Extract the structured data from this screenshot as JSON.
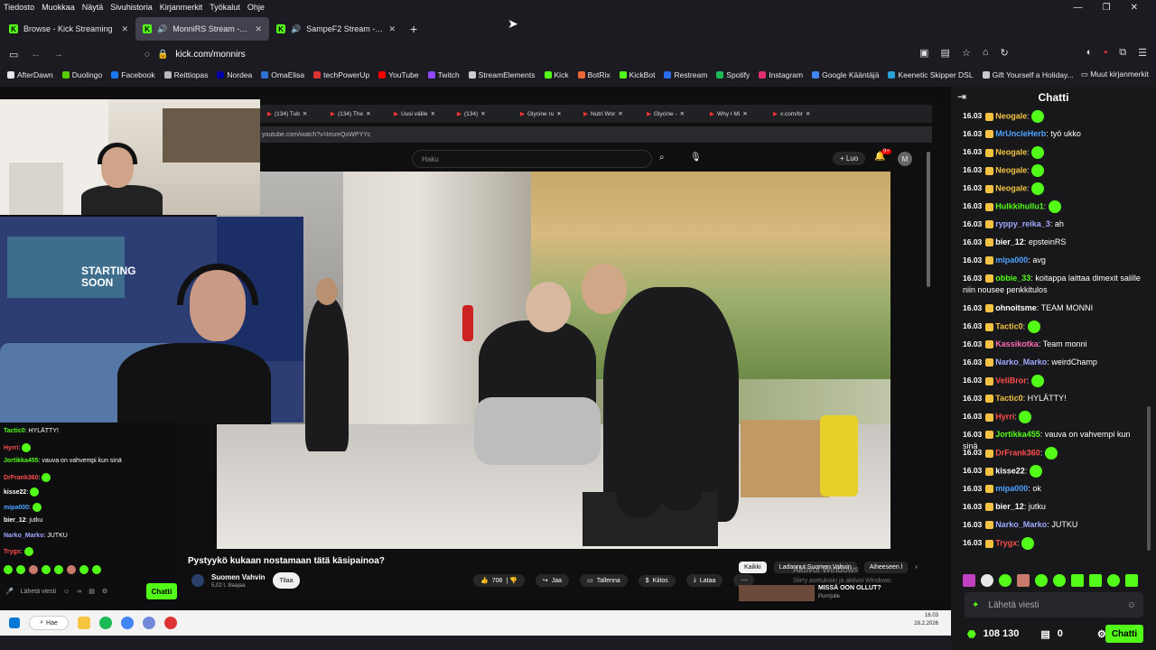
{
  "menubar": [
    "Tiedosto",
    "Muokkaa",
    "Näytä",
    "Sivuhistoria",
    "Kirjanmerkit",
    "Työkalut",
    "Ohje"
  ],
  "window_controls": [
    "—",
    "❐",
    "✕"
  ],
  "tabs": [
    {
      "label": "Browse - Kick Streaming",
      "active": false
    },
    {
      "label": "MonniRS Stream - Watch Li",
      "active": true
    },
    {
      "label": "SampeF2 Stream - Watch Li",
      "active": false
    }
  ],
  "new_tab": "+",
  "address": "kick.com/monnirs",
  "bookmarks": [
    {
      "label": "AfterDawn",
      "color": "#e8e8ea"
    },
    {
      "label": "Duolingo",
      "color": "#58cc02"
    },
    {
      "label": "Facebook",
      "color": "#1877f2"
    },
    {
      "label": "Reittiopas",
      "color": "#bbbbbb"
    },
    {
      "label": "Nordea",
      "color": "#0000a0"
    },
    {
      "label": "OmaElisa",
      "color": "#2f6fd6"
    },
    {
      "label": "techPowerUp",
      "color": "#d33"
    },
    {
      "label": "YouTube",
      "color": "#ff0000"
    },
    {
      "label": "Twitch",
      "color": "#9146ff"
    },
    {
      "label": "StreamElements",
      "color": "#cccccc"
    },
    {
      "label": "Kick",
      "color": "#53fc18"
    },
    {
      "label": "BotRix",
      "color": "#e63"
    },
    {
      "label": "KickBot",
      "color": "#53fc18"
    },
    {
      "label": "Restream",
      "color": "#2a6df4"
    },
    {
      "label": "Spotify",
      "color": "#1db954"
    },
    {
      "label": "Instagram",
      "color": "#e1306c"
    },
    {
      "label": "Google Kääntäjä",
      "color": "#4285f4"
    },
    {
      "label": "Keenetic Skipper DSL",
      "color": "#2a9fd6"
    },
    {
      "label": "Gift Yourself a Holiday...",
      "color": "#cccccc"
    }
  ],
  "other_bookmarks": "Muut kirjanmerkit",
  "youtube": {
    "tabs": [
      "(134) Tub",
      "(134) The",
      "Uusi välile",
      "(134) ",
      "Glycine ru",
      "Nutri Wor",
      "Glycine - ",
      "Why I Mi",
      "x.com/br"
    ],
    "url": "youtube.com/watch?v=ImzeQoWPYYc",
    "search_placeholder": "Haku",
    "create_label": "Luo",
    "notif_count": "9+",
    "avatar": "M",
    "video_title": "Pystyykö kukaan nostamaan tätä käsipainoa?",
    "channel": "Suomen Vahvin",
    "subs": "5,02 t. tilaajaa",
    "subscribe": "Tilaa",
    "likes": "706",
    "share": "Jaa",
    "save": "Tallenna",
    "thanks": "Kiitos",
    "download": "Lataa",
    "chips": [
      "Kaikki",
      "Ladannut Suomen Vahvin",
      "Aiheeseen l"
    ],
    "activate_title": "Aktivoi Windows",
    "activate_sub": "Siirry asetuksiin ja aktivoi Windows.",
    "rec_title": "MISSÄ OON OLLUT?",
    "rec_channel": "Purrrjulle"
  },
  "poster_text": "STARTING SOON",
  "overlay_chat": [
    {
      "user": "Tactic0",
      "text": "HYLÄTTY!",
      "color": "#53fc18"
    },
    {
      "user": "Hyrri",
      "text": "",
      "color": "#ff4d4d"
    },
    {
      "user": "Jortikka455",
      "text": "vauva on vahvempi kun sinä",
      "color": "#53fc18"
    },
    {
      "user": "DrFrank360",
      "text": "",
      "color": "#ff4d4d"
    },
    {
      "user": "kisse22",
      "text": "",
      "color": "#ffffff"
    },
    {
      "user": "mipa000",
      "text": "",
      "color": "#4ba3ff"
    },
    {
      "user": "bier_12",
      "text": "jutku",
      "color": "#ffffff"
    },
    {
      "user": "Narko_Marko",
      "text": "JUTKU",
      "color": "#a0a8ff"
    },
    {
      "user": "Trygx",
      "text": "",
      "color": "#ff4d4d"
    }
  ],
  "overlay_send_placeholder": "Lähetä viesti",
  "overlay_chat_btn": "Chatti",
  "taskbar": {
    "search": "Hae",
    "time": "16.03",
    "date": "28.2.2026"
  },
  "chat": {
    "title": "Chatti",
    "messages": [
      {
        "ts": "16.03",
        "user": "Neogale",
        "color": "#f4c242",
        "text": "",
        "emote": true
      },
      {
        "ts": "16.03",
        "user": "MrUncleHerb",
        "color": "#4ba3ff",
        "text": "työ ukko"
      },
      {
        "ts": "16.03",
        "user": "Neogale",
        "color": "#f4c242",
        "text": "",
        "emote": true
      },
      {
        "ts": "16.03",
        "user": "Neogale",
        "color": "#f4c242",
        "text": "",
        "emote": true
      },
      {
        "ts": "16.03",
        "user": "Neogale",
        "color": "#f4c242",
        "text": "",
        "emote": true
      },
      {
        "ts": "16.03",
        "user": "Hulkkihullu1",
        "color": "#53fc18",
        "text": "",
        "emote": true
      },
      {
        "ts": "16.03",
        "user": "ryppy_reika_3",
        "color": "#a0a8ff",
        "text": "ah"
      },
      {
        "ts": "16.03",
        "user": "bier_12",
        "color": "#ffffff",
        "text": "epsteinRS"
      },
      {
        "ts": "16.03",
        "user": "mipa000",
        "color": "#4ba3ff",
        "text": "avg"
      },
      {
        "ts": "16.03",
        "user": "obbie_33",
        "color": "#53fc18",
        "text": "koitappa laittaa dimexit salille niin nousee penkkitulos"
      },
      {
        "ts": "16.03",
        "user": "ohnoitsme",
        "color": "#ffffff",
        "text": "TEAM MONNI"
      },
      {
        "ts": "16.03",
        "user": "Tactic0",
        "color": "#f4c242",
        "text": "",
        "emote": true
      },
      {
        "ts": "16.03",
        "user": "Kassikotka",
        "color": "#ff6bb5",
        "text": "Team monni"
      },
      {
        "ts": "16.03",
        "user": "Narko_Marko",
        "color": "#a0a8ff",
        "text": "weirdChamp"
      },
      {
        "ts": "16.03",
        "user": "VeliBror",
        "color": "#ff4d4d",
        "text": "",
        "emote": true
      },
      {
        "ts": "16.03",
        "user": "Tactic0",
        "color": "#f4c242",
        "text": "HYLÄTTY!"
      },
      {
        "ts": "16.03",
        "user": "Hyrri",
        "color": "#ff4d4d",
        "text": "",
        "emote": true
      },
      {
        "ts": "16.03",
        "user": "Jortikka455",
        "color": "#53fc18",
        "text": "vauva on vahvempi kun sinä"
      },
      {
        "ts": "16.03",
        "user": "DrFrank360",
        "color": "#ff4d4d",
        "text": "",
        "emote": true
      },
      {
        "ts": "16.03",
        "user": "kisse22",
        "color": "#ffffff",
        "text": "",
        "emote": true
      },
      {
        "ts": "16.03",
        "user": "mipa000",
        "color": "#4ba3ff",
        "text": "ok"
      },
      {
        "ts": "16.03",
        "user": "bier_12",
        "color": "#ffffff",
        "text": "jutku"
      },
      {
        "ts": "16.03",
        "user": "Narko_Marko",
        "color": "#a0a8ff",
        "text": "JUTKU"
      },
      {
        "ts": "16.03",
        "user": "Trygx",
        "color": "#ff4d4d",
        "text": "",
        "emote": true
      }
    ],
    "input_placeholder": "Lähetä viesti",
    "points": "108 130",
    "count": "0",
    "send": "Chatti"
  }
}
